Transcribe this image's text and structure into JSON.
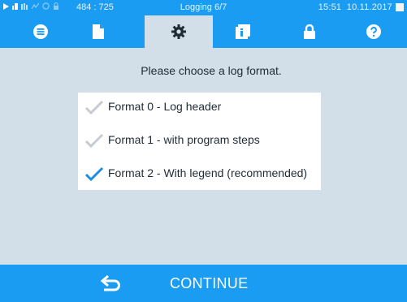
{
  "status_bar": {
    "coords": "484 : 725",
    "title": "Logging 6/7",
    "time": "15:51",
    "date": "10.11.2017",
    "icons": [
      "play-icon",
      "level-icon",
      "steam-icon",
      "curve-icon",
      "clock-icon",
      "lock-icon"
    ]
  },
  "tabs": [
    {
      "name": "menu",
      "icon": "list-icon",
      "active": false
    },
    {
      "name": "document",
      "icon": "document-icon",
      "active": false
    },
    {
      "name": "settings",
      "icon": "gear-icon",
      "active": true
    },
    {
      "name": "info",
      "icon": "info-book-icon",
      "active": false
    },
    {
      "name": "lock",
      "icon": "lock-icon",
      "active": false
    },
    {
      "name": "help",
      "icon": "help-icon",
      "active": false
    }
  ],
  "prompt": "Please choose a log format.",
  "options": [
    {
      "label": "Format 0 - Log header",
      "selected": false
    },
    {
      "label": "Format 1 - with program steps",
      "selected": false
    },
    {
      "label": "Format 2 - With legend (recommended)",
      "selected": true
    }
  ],
  "continue_button": {
    "label": "CONTINUE",
    "icon": "back-arrow-icon"
  },
  "colors": {
    "accent": "#1a9cf2",
    "background": "#d3dfe8",
    "check_selected": "#1a8fe0",
    "check_unselected": "#c6ccd1"
  }
}
